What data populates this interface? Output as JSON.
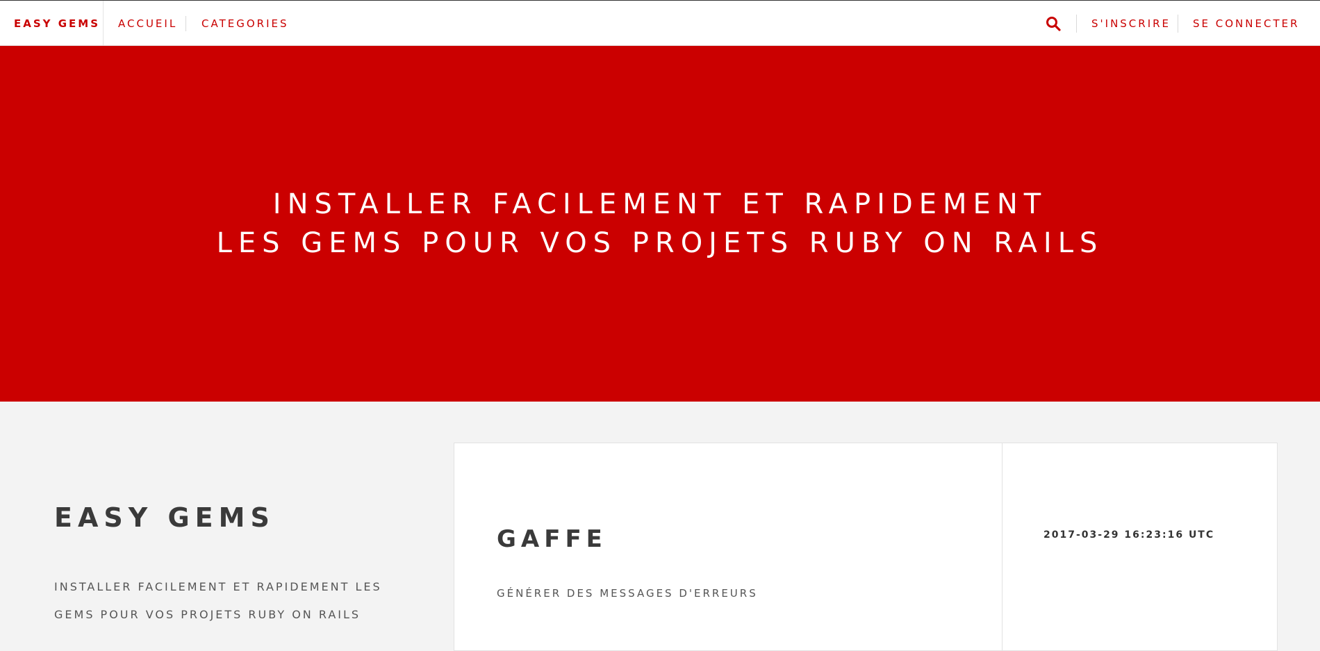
{
  "colors": {
    "brand": "#c90000",
    "hero_bg": "#cb0000",
    "page_bg": "#f3f3f3",
    "text_dark": "#3a3a3a"
  },
  "navbar": {
    "brand": "EASY GEMS",
    "links": [
      "ACCUEIL",
      "CATEGORIES"
    ],
    "search_icon": "search-icon",
    "signup": "S'INSCRIRE",
    "login": "SE CONNECTER"
  },
  "hero": {
    "line1": "INSTALLER FACILEMENT ET RAPIDEMENT",
    "line2": "LES GEMS POUR VOS PROJETS RUBY ON RAILS"
  },
  "sidebar": {
    "title": "EASY GEMS",
    "description": "INSTALLER FACILEMENT ET RAPIDEMENT LES GEMS POUR VOS PROJETS RUBY ON RAILS"
  },
  "gem_card": {
    "name": "GAFFE",
    "description": "GÉNÉRER DES MESSAGES D'ERREURS",
    "date": "2017-03-29 16:23:16 UTC"
  }
}
